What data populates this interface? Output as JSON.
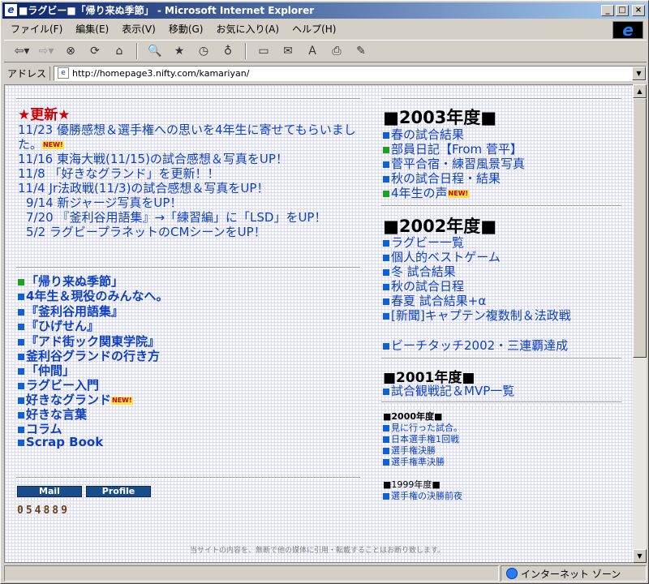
{
  "window": {
    "title": "■ラグビー■「帰り来ぬ季節」 - Microsoft Internet Explorer"
  },
  "menu": [
    "ファイル(F)",
    "編集(E)",
    "表示(V)",
    "移動(G)",
    "お気に入り(A)",
    "ヘルプ(H)"
  ],
  "address": {
    "label": "アドレス",
    "url": "http://homepage3.nifty.com/kamariyan/"
  },
  "status": {
    "zone": "インターネット ゾーン"
  },
  "updates": {
    "heading": "★更新★",
    "lines": [
      "11/23 優勝感想＆選手権への思いを4年生に寄せてもらいまし",
      "た。",
      "11/16 東海大戦(11/15)の試合感想＆写真をUP！",
      "11/8 「好きなグランド」を更新！！",
      "11/4  Jr法政戦(11/3)の試合感想＆写真をUP！",
      "9/14 新ジャージ写真をUP！",
      "7/20 『釜利谷用語集』→「練習編」に「LSD」をUP！",
      "5/2  ラグビープラネットのCMシーンをUP！"
    ],
    "new_badge": "NEW!"
  },
  "left_links": [
    "「帰り来ぬ季節」",
    "4年生＆現役のみんなへ。",
    "『釜利谷用語集』",
    "『ひげせん』",
    "『アド街ック関東学院』",
    "釜利谷グランドの行き方",
    "「仲間」",
    "ラグビー入門",
    "好きなグランド",
    "好きな言葉",
    "コラム",
    "Scrap Book"
  ],
  "buttons": {
    "mail": "Mail",
    "profile": "Profile"
  },
  "counter": "054889",
  "footer": "当サイトの内容を、無断で他の媒体に引用・転載することはお断り致します。",
  "right": {
    "y2003": {
      "title": "■2003年度■",
      "items": [
        "春の試合結果",
        "部員日記【From 菅平】",
        "菅平合宿・練習風景写真",
        "秋の試合日程・結果",
        "4年生の声"
      ]
    },
    "y2002": {
      "title": "■2002年度■",
      "items": [
        "ラグビー一覧",
        "個人的ベストゲーム",
        "冬 試合結果",
        "秋の試合日程",
        "春夏  試合結果+α",
        "[新聞]キャプテン複数制＆法政戦",
        "ビーチタッチ2002・三連覇達成"
      ]
    },
    "y2001": {
      "title": "■2001年度■",
      "items": [
        "試合観戦記＆MVP一覧"
      ]
    },
    "y2000": {
      "title": "■2000年度■",
      "items": [
        "見に行った試合。",
        "日本選手権1回戦",
        "選手権決勝",
        "選手権準決勝"
      ]
    },
    "y1999": {
      "title": "■1999年度■",
      "items": [
        "選手権の決勝前夜"
      ]
    }
  }
}
